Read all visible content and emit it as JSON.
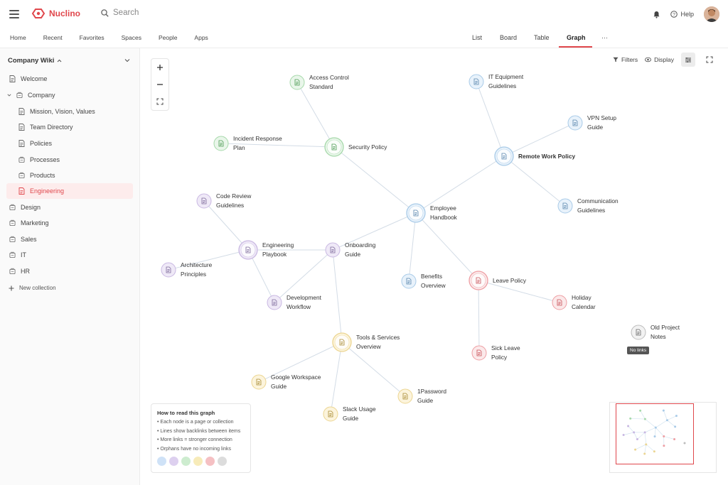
{
  "app": {
    "name": "Nuclino",
    "brand_color": "#e0474c"
  },
  "search": {
    "placeholder": "Search"
  },
  "header": {
    "help_label": "Help"
  },
  "nav": {
    "left": [
      "Home",
      "Recent",
      "Favorites",
      "Spaces",
      "People",
      "Apps"
    ],
    "views": [
      "List",
      "Board",
      "Table",
      "Graph",
      "···"
    ],
    "active_view": "Graph"
  },
  "sidebar": {
    "workspace": "Company Wiki",
    "items": [
      {
        "label": "Welcome",
        "icon": "document-icon",
        "level": 0
      },
      {
        "label": "Company",
        "icon": "collection-icon",
        "level": 0,
        "expanded": true
      },
      {
        "label": "Mission, Vision, Values",
        "icon": "document-icon",
        "level": 1
      },
      {
        "label": "Team Directory",
        "icon": "document-icon",
        "level": 1
      },
      {
        "label": "Policies",
        "icon": "document-icon",
        "level": 1
      },
      {
        "label": "Processes",
        "icon": "collection-icon",
        "level": 1
      },
      {
        "label": "Products",
        "icon": "collection-icon",
        "level": 1
      },
      {
        "label": "Engineering",
        "icon": "document-icon",
        "level": 1,
        "active": true
      },
      {
        "label": "Design",
        "icon": "collection-icon",
        "level": 0
      },
      {
        "label": "Marketing",
        "icon": "collection-icon",
        "level": 0
      },
      {
        "label": "Sales",
        "icon": "collection-icon",
        "level": 0
      },
      {
        "label": "IT",
        "icon": "collection-icon",
        "level": 0
      },
      {
        "label": "HR",
        "icon": "collection-icon",
        "level": 0
      }
    ],
    "new_collection": "New collection"
  },
  "toolbar": {
    "filters": "Filters",
    "display": "Display"
  },
  "graph": {
    "nodes": [
      {
        "id": "access",
        "label": [
          "Access Control",
          "Standard"
        ],
        "color": "green"
      },
      {
        "id": "incident",
        "label": [
          "Incident Response",
          "Plan"
        ],
        "color": "green"
      },
      {
        "id": "security",
        "label": [
          "Security Policy"
        ],
        "color": "green",
        "hub": true
      },
      {
        "id": "itequip",
        "label": [
          "IT Equipment",
          "Guidelines"
        ],
        "color": "blue"
      },
      {
        "id": "vpn",
        "label": [
          "VPN Setup",
          "Guide"
        ],
        "color": "blue"
      },
      {
        "id": "remote",
        "label": [
          "Remote Work Policy"
        ],
        "color": "blue",
        "hub": true,
        "bold": true
      },
      {
        "id": "comm",
        "label": [
          "Communication",
          "Guidelines"
        ],
        "color": "blue"
      },
      {
        "id": "handbook",
        "label": [
          "Employee",
          "Handbook"
        ],
        "color": "blue",
        "hub": true
      },
      {
        "id": "codereview",
        "label": [
          "Code Review",
          "Guidelines"
        ],
        "color": "purple"
      },
      {
        "id": "engplay",
        "label": [
          "Engineering",
          "Playbook"
        ],
        "color": "purple",
        "hub": true
      },
      {
        "id": "onboard",
        "label": [
          "Onboarding",
          "Guide"
        ],
        "color": "purple"
      },
      {
        "id": "arch",
        "label": [
          "Architecture",
          "Principles"
        ],
        "color": "purple"
      },
      {
        "id": "devflow",
        "label": [
          "Development",
          "Workflow"
        ],
        "color": "purple"
      },
      {
        "id": "benefits",
        "label": [
          "Benefits",
          "Overview"
        ],
        "color": "blue"
      },
      {
        "id": "leave",
        "label": [
          "Leave Policy"
        ],
        "color": "red",
        "hub": true
      },
      {
        "id": "holiday",
        "label": [
          "Holiday",
          "Calendar"
        ],
        "color": "red"
      },
      {
        "id": "sick",
        "label": [
          "Sick Leave",
          "Policy"
        ],
        "color": "red"
      },
      {
        "id": "oldproj",
        "label": [
          "Old Project",
          "Notes"
        ],
        "color": "gray",
        "orphan": true
      },
      {
        "id": "tools",
        "label": [
          "Tools & Services",
          "Overview"
        ],
        "color": "yellow",
        "hub": true
      },
      {
        "id": "gworkspace",
        "label": [
          "Google Workspace",
          "Guide"
        ],
        "color": "yellow"
      },
      {
        "id": "onepass",
        "label": [
          "1Password",
          "Guide"
        ],
        "color": "yellow"
      },
      {
        "id": "slack",
        "label": [
          "Slack Usage",
          "Guide"
        ],
        "color": "yellow"
      }
    ],
    "edges": [
      [
        "access",
        "security"
      ],
      [
        "incident",
        "security"
      ],
      [
        "security",
        "handbook"
      ],
      [
        "itequip",
        "remote"
      ],
      [
        "vpn",
        "remote"
      ],
      [
        "comm",
        "remote"
      ],
      [
        "remote",
        "handbook"
      ],
      [
        "handbook",
        "onboard"
      ],
      [
        "handbook",
        "benefits"
      ],
      [
        "handbook",
        "leave"
      ],
      [
        "leave",
        "holiday"
      ],
      [
        "leave",
        "sick"
      ],
      [
        "codereview",
        "engplay"
      ],
      [
        "engplay",
        "arch"
      ],
      [
        "engplay",
        "devflow"
      ],
      [
        "engplay",
        "onboard"
      ],
      [
        "onboard",
        "devflow"
      ],
      [
        "onboard",
        "tools"
      ],
      [
        "tools",
        "gworkspace"
      ],
      [
        "tools",
        "onepass"
      ],
      [
        "tools",
        "slack"
      ]
    ],
    "no_links_badge": "No links"
  },
  "palette": {
    "green": {
      "fill": "#e9f6ea",
      "stroke": "#a6d9aa",
      "ink": "#4a9a52"
    },
    "blue": {
      "fill": "#e8f2fb",
      "stroke": "#a9cbe8",
      "ink": "#5a86ad"
    },
    "purple": {
      "fill": "#efe9f7",
      "stroke": "#c9b8e2",
      "ink": "#7d6a9b"
    },
    "red": {
      "fill": "#fbe9ea",
      "stroke": "#ee9ea3",
      "ink": "#c95058"
    },
    "yellow": {
      "fill": "#fcf4dc",
      "stroke": "#ecd591",
      "ink": "#a88a33"
    },
    "gray": {
      "fill": "#f2f2f2",
      "stroke": "#bdbdbd",
      "ink": "#666"
    }
  },
  "legend": {
    "title": "How to read this graph",
    "lines": [
      "• Each node is a page or collection",
      "• Lines show backlinks between items",
      "• More links = stronger connection",
      "• Orphans have no incoming links"
    ],
    "dot_colors": [
      "#cfe2f7",
      "#ddd0ef",
      "#cdeccf",
      "#f7ebb9",
      "#f5c0c3",
      "#dcdcdc"
    ]
  }
}
